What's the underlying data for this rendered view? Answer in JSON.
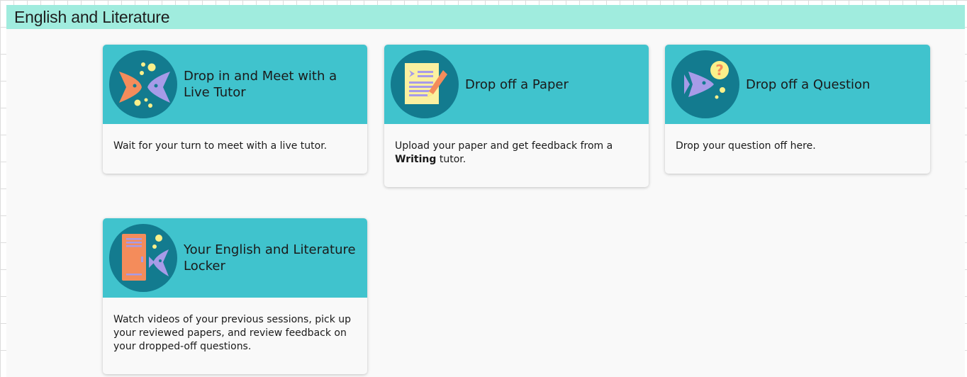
{
  "section": {
    "title": "English and Literature"
  },
  "cards": [
    {
      "title": "Drop in and Meet with a Live Tutor",
      "description": "Wait for your turn to meet with a live tutor.",
      "icon": "two-fish-icon"
    },
    {
      "title": "Drop off a Paper",
      "description_before": "Upload your paper and get feedback from a ",
      "description_bold": "Writing",
      "description_after": " tutor.",
      "icon": "paper-pencil-icon"
    },
    {
      "title": "Drop off a Question",
      "description": "Drop your question off here.",
      "icon": "fish-question-icon"
    },
    {
      "title": "Your English and Literature Locker",
      "description": "Watch videos of your previous sessions, pick up your reviewed papers, and review feedback on your dropped-off questions.",
      "icon": "locker-fish-icon"
    }
  ],
  "colors": {
    "header_band": "#a0ecde",
    "card_head": "#40c3cd",
    "icon_circle": "#137b8f",
    "fish_orange": "#f48c5b",
    "fish_purple": "#a79be8",
    "dot_yellow": "#fbf08a",
    "paper_yellow": "#fbf0a0"
  }
}
